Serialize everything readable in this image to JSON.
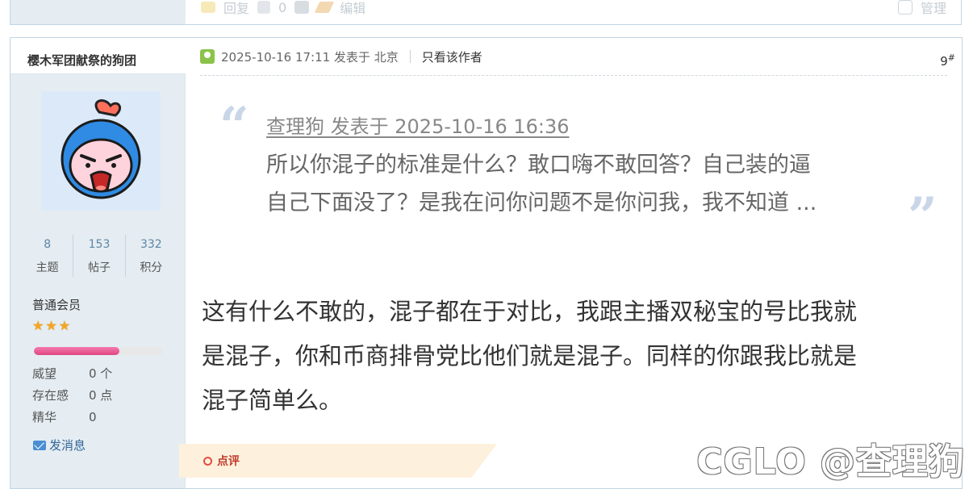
{
  "prev_post": {
    "reply_label": "回复",
    "support_count": "0",
    "edit_label": "编辑",
    "manage_label": "管理"
  },
  "post": {
    "username": "樱木军团献祭的狗团",
    "stats": [
      {
        "value": "8",
        "label": "主题"
      },
      {
        "value": "153",
        "label": "帖子"
      },
      {
        "value": "332",
        "label": "积分"
      }
    ],
    "user_group": "普通会员",
    "star_count": 3,
    "progress_fraction": 0.66,
    "info": [
      {
        "key": "威望",
        "value": "0 个"
      },
      {
        "key": "存在感",
        "value": "0 点"
      },
      {
        "key": "精华",
        "value": "0"
      }
    ],
    "send_message_label": "发消息",
    "timestamp": "2025-10-16 17:11 发表于 北京",
    "author_only_label": "只看该作者",
    "floor_number": "9",
    "floor_symbol": "#",
    "quote": {
      "source": "查理狗 发表于 2025-10-16 16:36",
      "line1": "所以你混子的标准是什么？敢口嗨不敢回答？自己装的逼",
      "line2": "自己下面没了？是我在问你问题不是你问我，我不知道 ..."
    },
    "body_lines": [
      "这有什么不敢的，混子都在于对比，我跟主播双秘宝的号比我就",
      "是混子，你和币商排骨党比他们就是混子。同样的你跟我比就是",
      "混子简单么。"
    ],
    "comment_label": "点评"
  },
  "watermark": "CGLO @查理狗",
  "colors": {
    "sidebar_bg": "#e5edf2",
    "border": "#c2d5e3",
    "progress": "#e0457f",
    "comment_bg": "#fdf1dd"
  }
}
